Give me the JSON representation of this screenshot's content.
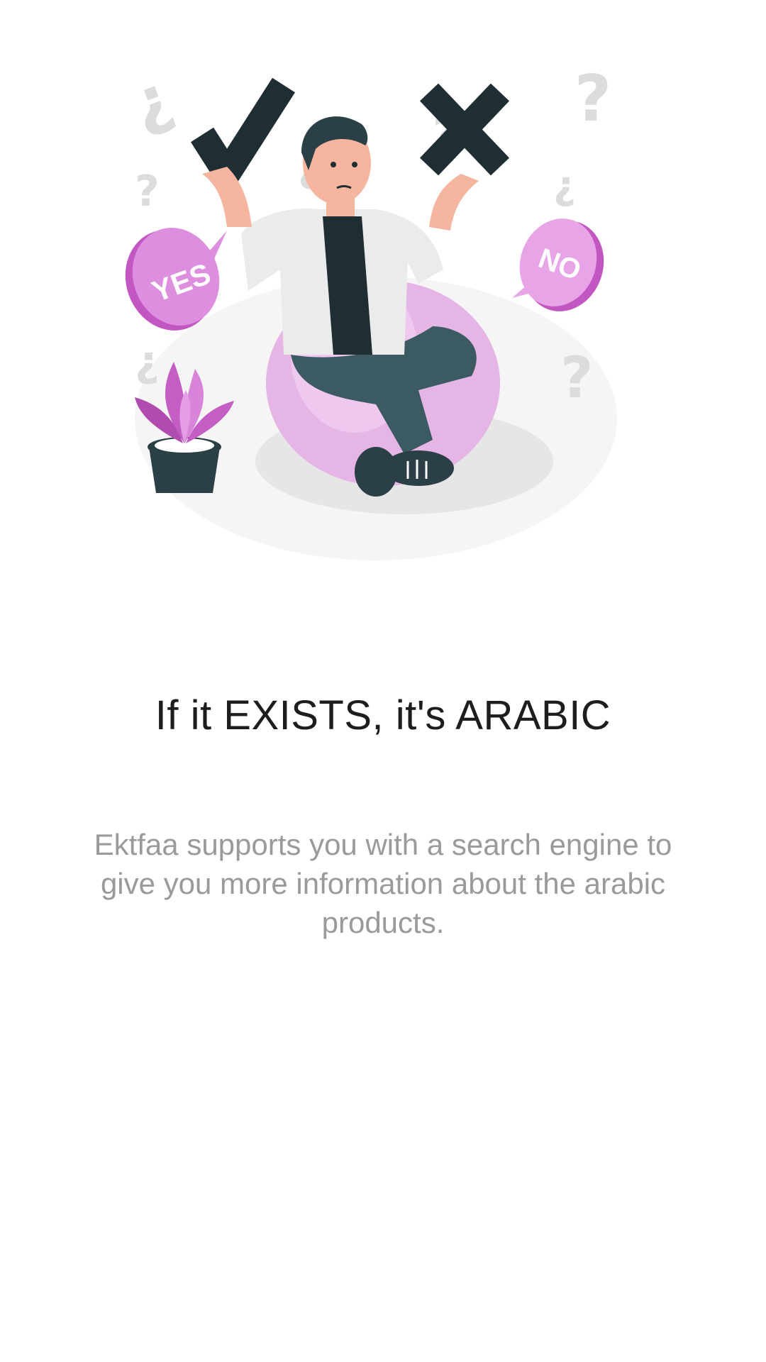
{
  "onboarding": {
    "illustration": {
      "description_icon": "decision-person-illustration",
      "yes_bubble": "YES",
      "no_bubble": "NO"
    },
    "title": "If it EXISTS, it's ARABIC",
    "description": "Ektfaa supports you with a search engine to give you more information about the arabic products."
  },
  "colors": {
    "background": "#ffffff",
    "title": "#1d1d1d",
    "description": "#9a9a9a",
    "accent_pink": "#d884d8",
    "accent_dark": "#2b3f46"
  }
}
